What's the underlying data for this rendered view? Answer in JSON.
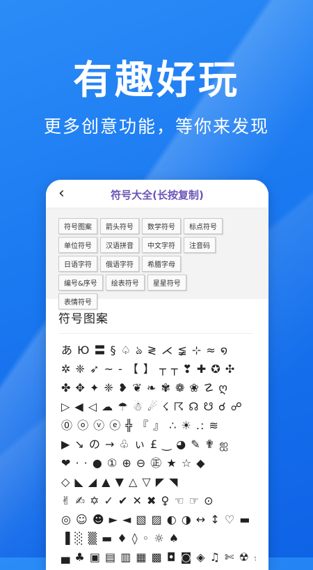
{
  "hero": {
    "title": "有趣好玩",
    "subtitle": "更多创意功能，等你来发现"
  },
  "app": {
    "back_icon": "‹",
    "title": "符号大全(长按复制)"
  },
  "categories": [
    "符号图案",
    "箭头符号",
    "数学符号",
    "标点符号",
    "单位符号",
    "汉语拼音",
    "中文字符",
    "注音码",
    "日语字符",
    "俄语字符",
    "希腊字母",
    "编号&序号",
    "绘表符号",
    "星星符号",
    "表情符号"
  ],
  "section": {
    "title": "符号图案"
  },
  "symbol_rows": [
    "あ Ю 〓 § ♤ ঌ ≷ ⋌ ≨ ⊹ ≈       ໑",
    "✲ ❈ ➶ ~ - 【 】 ┬ ┬ ❣ ✚ ✪ ✣",
    "✤ ✥ ✦ ❈ ❥ ❦ ❧ ✾ ❁ ❀ ☡ ღ",
    "▷ ◀ ◁ ☁ ☂ ☃ ☄ ☇ ☈ ☊ ☋ ☌ ☍",
    "⓪ ⓞ ⓥ ⓔ ╬ 『 』 ∴ ☀ .: ≋",
    "▶ ↘ の → ♧ ぃ £ ‿ ◕ ✎ ✟ ஐ",
    "❤ · · ● ① ⊕ ⊖ ㊣ ★ ☆ ◆",
    "◇ ◣ ◢ ▲ ▼ △ ▽ ◤ ◥",
    "✌ ✍ ✡ ✓ ✔ ✕ ✖ ♀ ☜ ☞ ⊙",
    "◎ ☺ ☻ ► ◄ ▧ ▨ ◐ ◑ ↔ ↕ ♡ ▬",
    "▐ ░ ▒ ▬ ♦ ◊ ◦ ☼ ♠",
    "▄ ♣ ▣ ▤ ▥ ▦ ▩ ◘ ◙ ◈ ♫ ✄ ☢ ☠"
  ]
}
